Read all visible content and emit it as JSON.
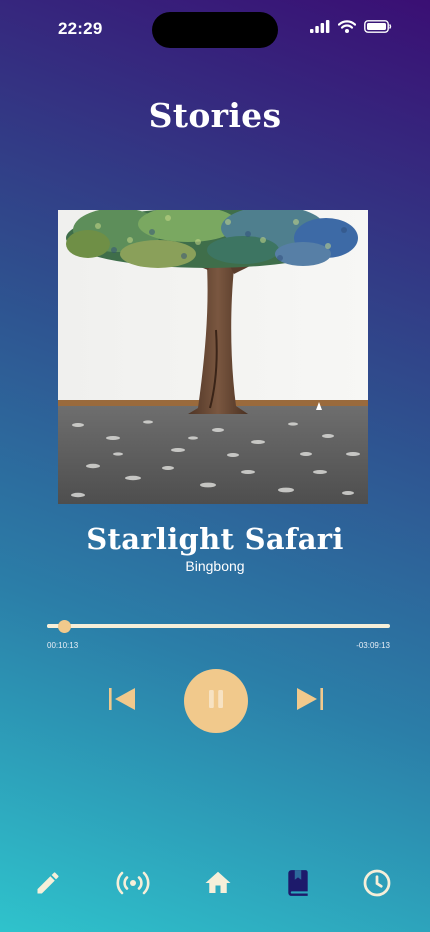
{
  "status_bar": {
    "time": "22:29",
    "icons": [
      "cellular-signal-icon",
      "wifi-icon",
      "battery-icon"
    ]
  },
  "page": {
    "title": "Stories"
  },
  "player": {
    "cover_art": "tree-sculpture-artwork",
    "title": "Starlight Safari",
    "artist": "Bingbong",
    "elapsed": "00:10:13",
    "remaining": "-03:09:13",
    "progress": 0.05,
    "state": "playing",
    "controls": [
      "skip-previous-icon",
      "pause-icon",
      "skip-next-icon"
    ]
  },
  "bottom_nav": {
    "items": [
      {
        "icon": "pencil-icon",
        "active": false
      },
      {
        "icon": "broadcast-icon",
        "active": false
      },
      {
        "icon": "home-icon",
        "active": false
      },
      {
        "icon": "book-icon",
        "active": true
      },
      {
        "icon": "clock-icon",
        "active": false
      }
    ]
  },
  "colors": {
    "gradient_top": "#3a0f74",
    "gradient_bottom": "#2fc3cc",
    "accent": "#f1c98c",
    "active_nav": "#1d1a6b",
    "inactive_nav": "#f6efd9"
  }
}
